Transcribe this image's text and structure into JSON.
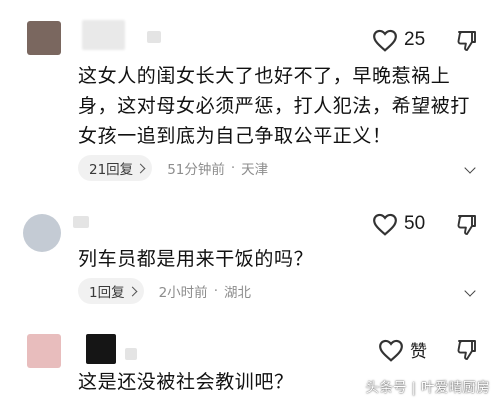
{
  "colors": {
    "text": "#111111",
    "meta": "#8d8d8d",
    "reply_bg": "#f1f1f1",
    "avatar1": "#7a675f",
    "avatar3": "#e8bdbd"
  },
  "comments": [
    {
      "like_count": "25",
      "text": "这女人的闺女长大了也好不了，早晚惹祸上身，这对母女必须严惩，打人犯法，希望被打女孩一追到底为自己争取公平正义！",
      "reply_label": "21回复",
      "time": "51分钟前",
      "location": "天津"
    },
    {
      "like_count": "50",
      "text": "列车员都是用来干饭的吗？",
      "reply_label": "1回复",
      "time": "2小时前",
      "location": "湖北"
    },
    {
      "like_count": "赞",
      "text": "这是还没被社会教训吧？"
    }
  ],
  "watermark": {
    "source": "头条号",
    "author": "叶爱晴厨房"
  },
  "icons": {
    "like": "heart-outline-icon",
    "dislike": "thumbs-down-outline-icon",
    "more": "chevron-down-icon",
    "reply_arrow": "chevron-right-icon"
  }
}
